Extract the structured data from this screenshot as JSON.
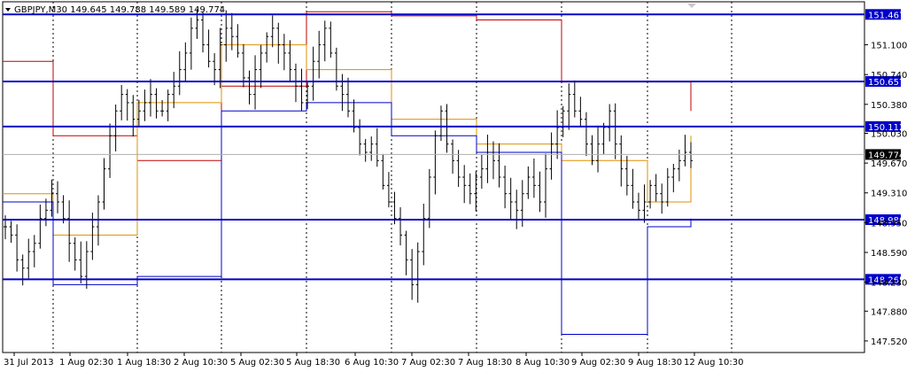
{
  "header": {
    "symbol": "GBPJPY,M30",
    "ohlc": "149.645 149.788 149.589 149.774"
  },
  "colors": {
    "background": "#ffffff",
    "bars": "#000000",
    "grid": "#000000",
    "level_line": "#0000c8",
    "level_tag": "#0000c8",
    "price_tag": "#000000",
    "pivot_red": "#c00000",
    "pivot_orange": "#e09000",
    "pivot_blue": "#0000c8"
  },
  "chart_data": {
    "type": "ohlc",
    "title": "GBPJPY,M30",
    "ylim": [
      147.38,
      151.62
    ],
    "current_price": 149.774,
    "price_ticks": [
      "151.100",
      "150.740",
      "150.380",
      "150.030",
      "149.670",
      "149.310",
      "148.950",
      "148.590",
      "148.230",
      "147.880",
      "147.520"
    ],
    "horizontal_levels": [
      {
        "value": 151.467,
        "label": "151.467"
      },
      {
        "value": 150.657,
        "label": "150.657"
      },
      {
        "value": 150.112,
        "label": "150.112"
      },
      {
        "value": 148.986,
        "label": "148.986"
      },
      {
        "value": 148.265,
        "label": "148.265"
      }
    ],
    "time_labels": [
      "31 Jul 2013",
      "1 Aug 02:30",
      "1 Aug 18:30",
      "2 Aug 10:30",
      "5 Aug 02:30",
      "5 Aug 18:30",
      "6 Aug 10:30",
      "7 Aug 02:30",
      "7 Aug 18:30",
      "8 Aug 10:30",
      "9 Aug 02:30",
      "9 Aug 18:30",
      "12 Aug 10:30"
    ],
    "series_close": [
      148.9,
      148.8,
      148.5,
      148.4,
      148.6,
      148.7,
      149.0,
      149.1,
      149.3,
      149.2,
      149.0,
      148.7,
      148.5,
      148.3,
      148.6,
      148.9,
      149.2,
      149.6,
      150.0,
      150.3,
      150.5,
      150.4,
      150.2,
      150.3,
      150.4,
      150.5,
      150.3,
      150.3,
      150.5,
      150.6,
      150.8,
      151.0,
      151.3,
      151.4,
      151.1,
      150.9,
      150.8,
      151.1,
      151.3,
      151.2,
      151.0,
      150.7,
      150.5,
      150.8,
      151.0,
      151.2,
      151.3,
      151.1,
      151.0,
      150.8,
      150.6,
      150.4,
      150.6,
      150.9,
      151.1,
      151.3,
      151.0,
      150.6,
      150.5,
      150.3,
      150.1,
      149.9,
      149.8,
      149.9,
      149.7,
      149.4,
      149.2,
      149.0,
      148.8,
      148.5,
      148.2,
      148.6,
      149.0,
      149.5,
      150.0,
      150.3,
      149.9,
      149.7,
      149.5,
      149.4,
      149.3,
      149.5,
      149.6,
      149.8,
      149.7,
      149.5,
      149.3,
      149.2,
      149.1,
      149.3,
      149.5,
      149.4,
      149.2,
      149.6,
      149.9,
      150.1,
      150.3,
      150.5,
      150.3,
      150.2,
      149.9,
      149.7,
      149.9,
      150.1,
      150.3,
      149.9,
      149.6,
      149.4,
      149.2,
      149.1,
      149.2,
      149.4,
      149.3,
      149.2,
      149.5,
      149.6,
      149.7,
      149.8,
      149.7
    ],
    "pivot_lines": {
      "red": [
        [
          0,
          150.9
        ],
        [
          1,
          150.0
        ],
        [
          2,
          149.7
        ],
        [
          3,
          150.6
        ],
        [
          4,
          151.5
        ],
        [
          5,
          151.45
        ],
        [
          6,
          151.4
        ],
        [
          7,
          150.65
        ],
        [
          8,
          150.65
        ],
        [
          9,
          150.3
        ],
        [
          10,
          150.3
        ]
      ],
      "orange": [
        [
          0,
          149.3
        ],
        [
          1,
          148.8
        ],
        [
          2,
          150.4
        ],
        [
          3,
          151.1
        ],
        [
          4,
          150.8
        ],
        [
          5,
          150.2
        ],
        [
          6,
          149.9
        ],
        [
          7,
          149.7
        ],
        [
          8,
          149.2
        ],
        [
          9,
          150.0
        ],
        [
          10,
          149.1
        ]
      ],
      "blue": [
        [
          0,
          149.2
        ],
        [
          1,
          148.2
        ],
        [
          2,
          148.3
        ],
        [
          3,
          150.3
        ],
        [
          4,
          150.4
        ],
        [
          5,
          150.0
        ],
        [
          6,
          149.8
        ],
        [
          7,
          147.6
        ],
        [
          8,
          148.9
        ],
        [
          9,
          149.0
        ],
        [
          10,
          149.0
        ]
      ]
    }
  }
}
